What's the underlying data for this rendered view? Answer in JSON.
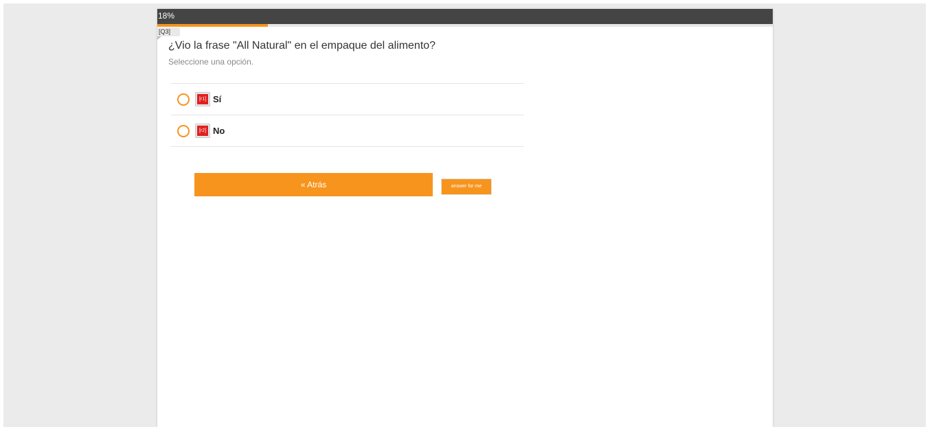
{
  "progress": {
    "label": "18%",
    "fraction": 0.18,
    "fill_color": "#f7941d"
  },
  "question": {
    "tag": "[Q3]",
    "title": "¿Vio la frase \"All Natural\" en el empaque del alimento?",
    "instructions": "Seleccione una opción."
  },
  "answers": [
    {
      "tag": "[r1]",
      "label": "Sí",
      "selected": false
    },
    {
      "tag": "[r2]",
      "label": "No",
      "selected": false
    }
  ],
  "buttons": {
    "back_label": "« Atrás",
    "answer_for_me_label": "answer for me"
  },
  "colors": {
    "accent": "#f7941d",
    "header": "#444444",
    "tag_red": "#e02020"
  }
}
